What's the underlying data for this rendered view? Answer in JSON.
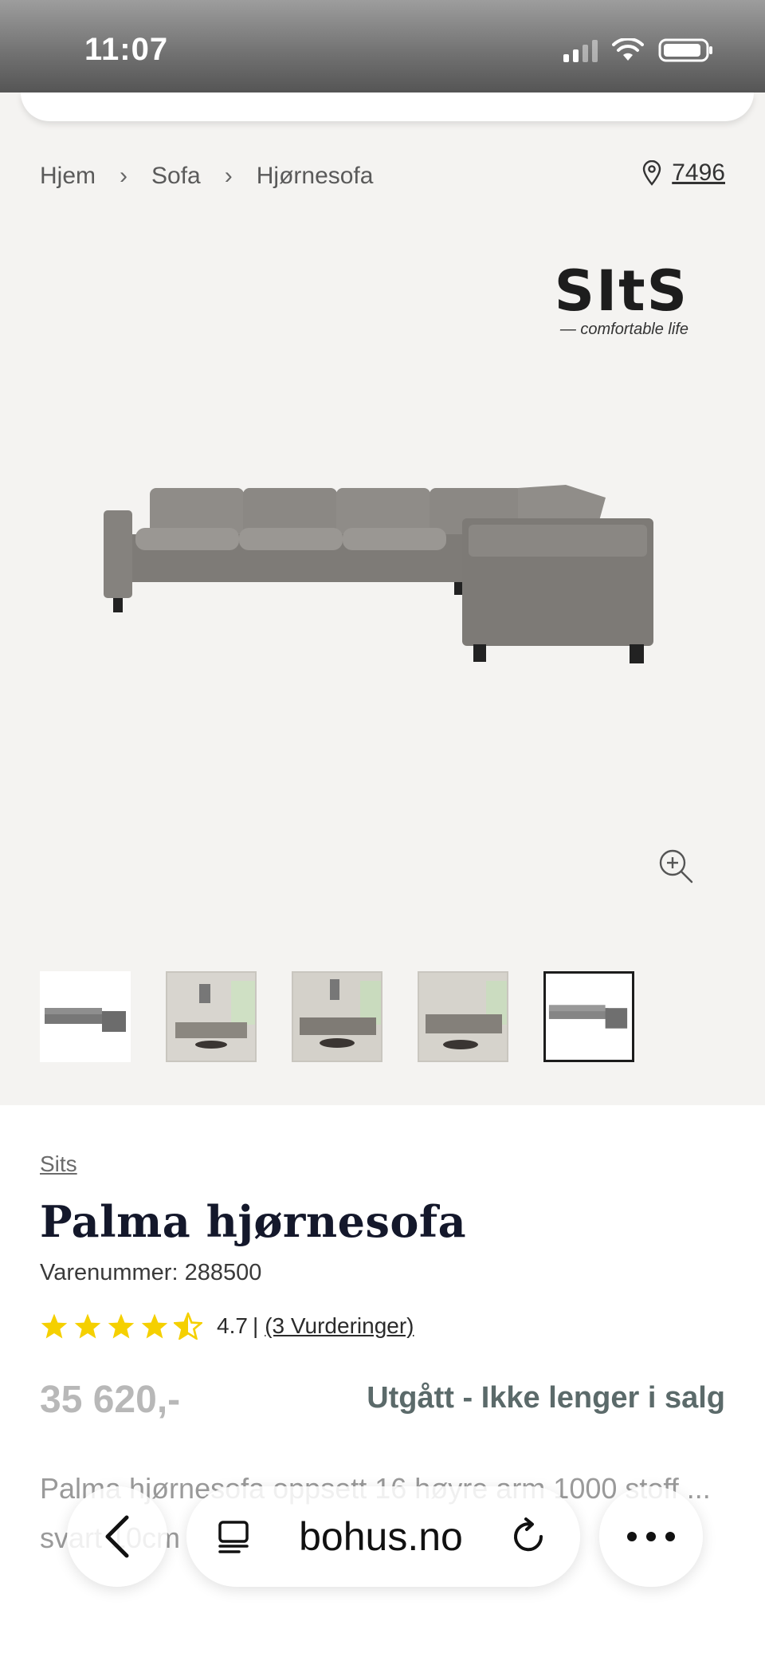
{
  "status_bar": {
    "time": "11:07"
  },
  "breadcrumb": {
    "items": [
      "Hjem",
      "Sofa",
      "Hjørnesofa"
    ],
    "separator": ">"
  },
  "store": {
    "number": "7496"
  },
  "brand_logo": {
    "word": "SItS",
    "tagline": "— comfortable life"
  },
  "product": {
    "brand": "Sits",
    "title": "Palma hjørnesofa",
    "sku_label": "Varenummer:",
    "sku": "288500",
    "rating_value": "4.7",
    "rating_separator": "|",
    "reviews_link": "(3 Vurderinger)",
    "rating_fraction": 0.94,
    "price": "35 620,-",
    "availability": "Utgått - Ikke lenger i salg",
    "description": "Palma hjørnesofa oppsett 16 høyre arm 1000 stoff ... svart 10cm"
  },
  "thumbnails": [
    {
      "name": "sofa-product",
      "active": false
    },
    {
      "name": "room-scene-1",
      "active": false
    },
    {
      "name": "room-scene-2",
      "active": false
    },
    {
      "name": "room-scene-3",
      "active": false
    },
    {
      "name": "sofa-product-alt",
      "active": true
    }
  ],
  "browser": {
    "domain": "bohus.no"
  },
  "colors": {
    "title": "#14182b",
    "star": "#f5d000",
    "price": "#b8b8b8",
    "availability": "#5b6a6a",
    "background": "#f4f3f1"
  },
  "icons": [
    "location-pin-icon",
    "zoom-in-icon",
    "star-icon",
    "back-arrow-icon",
    "reader-icon",
    "reload-icon",
    "more-icon"
  ]
}
